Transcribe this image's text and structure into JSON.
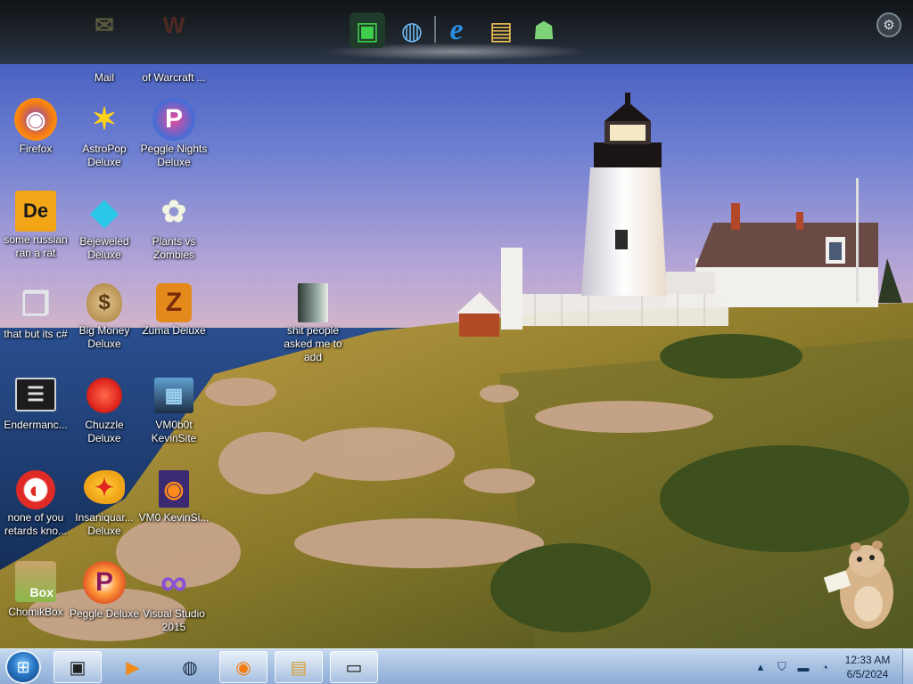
{
  "dock": {
    "items": [
      {
        "icon": "cube-app-icon",
        "glyph": "▣"
      },
      {
        "icon": "download-globe-icon",
        "glyph": "◍"
      },
      {
        "icon": "internet-explorer-icon",
        "glyph": "e"
      },
      {
        "icon": "photo-viewer-icon",
        "glyph": "▤"
      },
      {
        "icon": "network-users-icon",
        "glyph": "☗"
      }
    ],
    "settings_glyph": "⚙"
  },
  "desktop_icons": [
    {
      "name": "mail",
      "label": "Mail",
      "glyph": "✉",
      "color": "#d9c46a",
      "faded": true
    },
    {
      "name": "world-of-warcraft",
      "label": "of Warcraft ...",
      "glyph": "W",
      "color": "#b33a1f",
      "faded": true
    },
    {
      "name": "firefox",
      "label": "Firefox",
      "glyph": "◉",
      "color": "#f57c12"
    },
    {
      "name": "astropop-deluxe",
      "label": "AstroPop Deluxe",
      "glyph": "✶",
      "color": "#e83a1a"
    },
    {
      "name": "peggle-nights-deluxe",
      "label": "Peggle Nights Deluxe",
      "glyph": "P",
      "color": "#3f6fd8"
    },
    {
      "name": "some-russian-ran-a-rat",
      "label": "some russian ran a rat",
      "glyph": "De",
      "color": "#f2a516"
    },
    {
      "name": "bejeweled-deluxe",
      "label": "Bejeweled Deluxe",
      "glyph": "◆",
      "color": "#2bc7e8"
    },
    {
      "name": "plants-vs-zombies",
      "label": "Plants vs Zombies",
      "glyph": "✿",
      "color": "#4aa034"
    },
    {
      "name": "that-but-its-csharp",
      "label": "that but its c#",
      "glyph": "❐",
      "color": "#c9ced6"
    },
    {
      "name": "big-money-deluxe",
      "label": "Big Money Deluxe",
      "glyph": "$",
      "color": "#b89454"
    },
    {
      "name": "zuma-deluxe",
      "label": "Zuma Deluxe",
      "glyph": "Z",
      "color": "#e48a1c"
    },
    {
      "name": "shit-people-asked-me-to-add",
      "label": "shit people asked me to add",
      "glyph": "▮",
      "color": "#8fa39a"
    },
    {
      "name": "endermanc",
      "label": "Endermanc...",
      "glyph": "☰",
      "color": "#2b2b2b"
    },
    {
      "name": "chuzzle-deluxe",
      "label": "Chuzzle Deluxe",
      "glyph": "●",
      "color": "#e0261f"
    },
    {
      "name": "vm0b0t-kevinsite",
      "label": "VM0b0t KevinSite",
      "glyph": "▦",
      "color": "#2b4a72"
    },
    {
      "name": "none-of-you-retards-kno",
      "label": "none of you retards kno...",
      "glyph": "◐",
      "color": "#e02a26"
    },
    {
      "name": "insaniquarium-deluxe",
      "label": "Insaniquar... Deluxe",
      "glyph": "✦",
      "color": "#f0a418"
    },
    {
      "name": "vm0-kevinsi",
      "label": "VM0 KevinSi...",
      "glyph": "◉",
      "color": "#6a3fb8"
    },
    {
      "name": "chomikbox",
      "label": "ChomikBox",
      "glyph": "Box",
      "color": "#8ab84a"
    },
    {
      "name": "peggle-deluxe",
      "label": "Peggle Deluxe",
      "glyph": "P",
      "color": "#e25a26"
    },
    {
      "name": "visual-studio-2015",
      "label": "Visual Studio 2015",
      "glyph": "∞",
      "color": "#7a3fb8"
    }
  ],
  "taskbar": {
    "start_glyph": "⊞",
    "buttons": [
      {
        "icon": "media-player-icon",
        "glyph": "▣"
      },
      {
        "icon": "media-center-icon",
        "glyph": "▶"
      },
      {
        "icon": "globe-app-icon",
        "glyph": "◍"
      },
      {
        "icon": "firefox-taskbar-icon",
        "glyph": "◉"
      },
      {
        "icon": "file-explorer-icon",
        "glyph": "▤"
      },
      {
        "icon": "virtual-machine-icon",
        "glyph": "▭"
      }
    ],
    "tray": [
      {
        "icon": "chevron-up-icon",
        "glyph": "▴"
      },
      {
        "icon": "security-shield-icon",
        "glyph": "⛉"
      },
      {
        "icon": "monitor-network-icon",
        "glyph": "▬"
      },
      {
        "icon": "volume-icon",
        "glyph": "◔"
      }
    ],
    "time": "12:33 AM",
    "date": "6/5/2024"
  },
  "colors": {
    "sky": "#5a72cc",
    "sea": "#163668",
    "taskbar": "#a8c2e2"
  }
}
